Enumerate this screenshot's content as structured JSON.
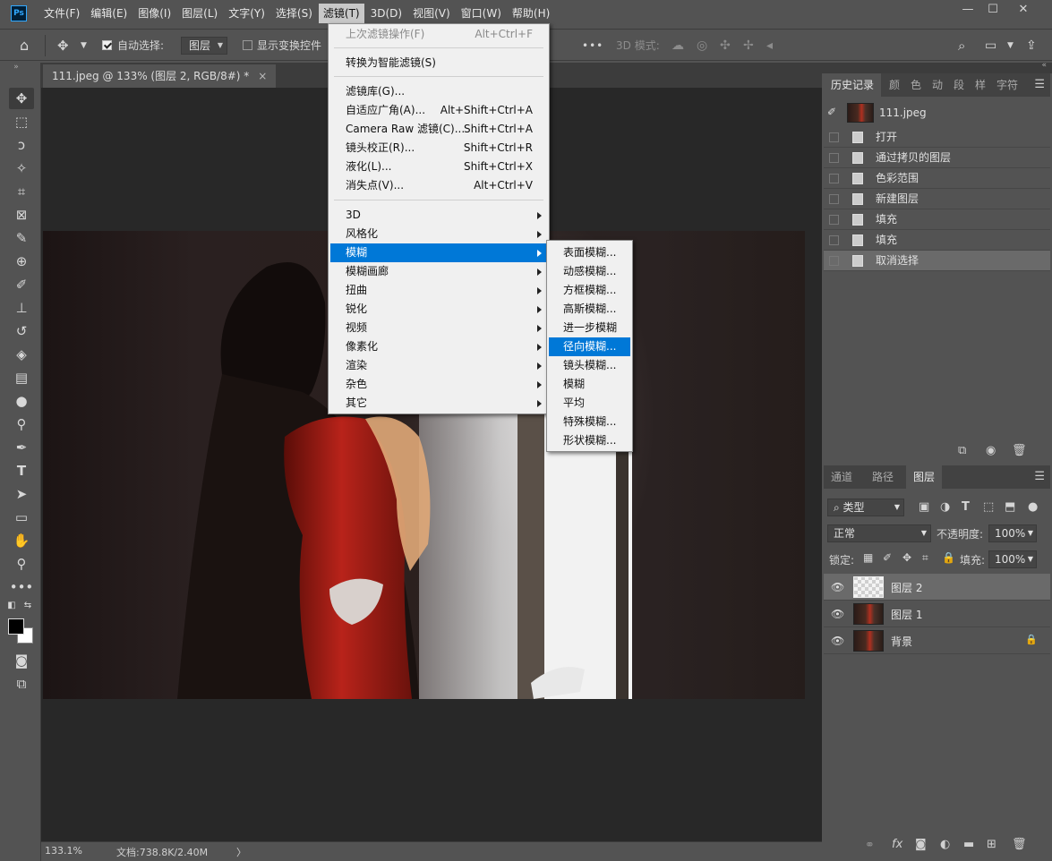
{
  "menubar": {
    "logo": "Ps",
    "items": [
      "文件(F)",
      "编辑(E)",
      "图像(I)",
      "图层(L)",
      "文字(Y)",
      "选择(S)",
      "滤镜(T)",
      "3D(D)",
      "视图(V)",
      "窗口(W)",
      "帮助(H)"
    ],
    "active_index": 6,
    "minimize": "—",
    "maximize": "☐",
    "close": "✕"
  },
  "options": {
    "auto_select_label": "自动选择:",
    "auto_select_checked": true,
    "target_value": "图层",
    "show_transform_label": "显示变换控件",
    "show_transform_checked": false,
    "more": "•••",
    "mode_3d_label": "3D 模式:"
  },
  "document": {
    "tab_title": "111.jpeg @ 133% (图层 2, RGB/8#) *",
    "tab_close": "×",
    "zoom": "133.1%",
    "doc_info": "文档:738.8K/2.40M",
    "status_arrow": "〉"
  },
  "filter_menu": {
    "items": [
      {
        "label": "上次滤镜操作(F)",
        "shortcut": "Alt+Ctrl+F",
        "disabled": true
      },
      {
        "label": "转换为智能滤镜(S)",
        "shortcut": ""
      },
      {
        "label": "滤镜库(G)...",
        "shortcut": ""
      },
      {
        "label": "自适应广角(A)...",
        "shortcut": "Alt+Shift+Ctrl+A"
      },
      {
        "label": "Camera Raw 滤镜(C)...",
        "shortcut": "Shift+Ctrl+A"
      },
      {
        "label": "镜头校正(R)...",
        "shortcut": "Shift+Ctrl+R"
      },
      {
        "label": "液化(L)...",
        "shortcut": "Shift+Ctrl+X"
      },
      {
        "label": "消失点(V)...",
        "shortcut": "Alt+Ctrl+V"
      },
      {
        "label": "3D",
        "submenu": true
      },
      {
        "label": "风格化",
        "submenu": true
      },
      {
        "label": "模糊",
        "submenu": true,
        "highlighted": true
      },
      {
        "label": "模糊画廊",
        "submenu": true
      },
      {
        "label": "扭曲",
        "submenu": true
      },
      {
        "label": "锐化",
        "submenu": true
      },
      {
        "label": "视频",
        "submenu": true
      },
      {
        "label": "像素化",
        "submenu": true
      },
      {
        "label": "渲染",
        "submenu": true
      },
      {
        "label": "杂色",
        "submenu": true
      },
      {
        "label": "其它",
        "submenu": true
      }
    ]
  },
  "blur_submenu": {
    "items": [
      "表面模糊...",
      "动感模糊...",
      "方框模糊...",
      "高斯模糊...",
      "进一步模糊",
      "径向模糊...",
      "镜头模糊...",
      "模糊",
      "平均",
      "特殊模糊...",
      "形状模糊..."
    ],
    "highlighted_index": 5
  },
  "history_panel": {
    "tabs": [
      "历史记录",
      "颜",
      "色",
      "动",
      "段",
      "样",
      "字符"
    ],
    "active_tab": 0,
    "snapshot_name": "111.jpeg",
    "steps": [
      "打开",
      "通过拷贝的图层",
      "色彩范围",
      "新建图层",
      "填充",
      "填充",
      "取消选择"
    ],
    "selected_step": 6
  },
  "layers_panel": {
    "tabs": [
      "通道",
      "路径",
      "图层"
    ],
    "active_tab": 2,
    "filter_kind": "类型",
    "blend_mode": "正常",
    "opacity_label": "不透明度:",
    "opacity_value": "100%",
    "lock_label": "锁定:",
    "fill_label": "填充:",
    "fill_value": "100%",
    "layers": [
      {
        "name": "图层 2",
        "selected": true,
        "locked": false,
        "transparent": true
      },
      {
        "name": "图层 1",
        "selected": false,
        "locked": false,
        "transparent": false
      },
      {
        "name": "背景",
        "selected": false,
        "locked": true,
        "transparent": false
      }
    ]
  },
  "colors": {
    "highlight": "#0078d7",
    "panel_bg": "#535353",
    "canvas_bg": "#282828"
  }
}
